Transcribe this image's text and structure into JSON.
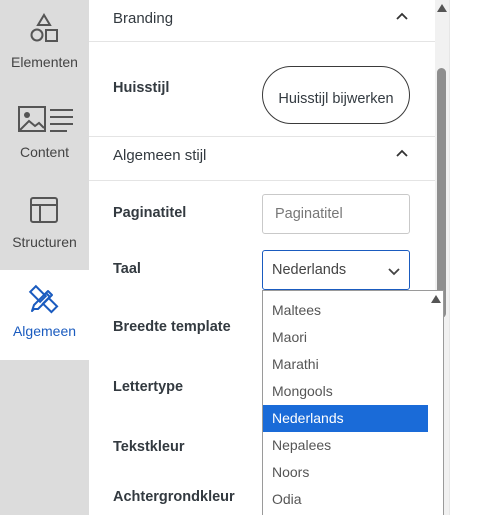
{
  "rail": {
    "items": [
      {
        "label": "Elementen",
        "icon": "shapes-icon"
      },
      {
        "label": "Content",
        "icon": "image-text-icon"
      },
      {
        "label": "Structuren",
        "icon": "layout-icon"
      },
      {
        "label": "Algemeen",
        "icon": "pencil-ruler-icon",
        "active": true
      }
    ]
  },
  "sections": {
    "branding": {
      "title": "Branding"
    },
    "huisstijl": {
      "label": "Huisstijl",
      "button": "Huisstijl bijwerken"
    },
    "algemeen": {
      "title": "Algemeen stijl"
    }
  },
  "fields": {
    "paginatitel": {
      "label": "Paginatitel",
      "placeholder": "Paginatitel"
    },
    "taal": {
      "label": "Taal",
      "value": "Nederlands"
    },
    "breedte": {
      "label": "Breedte template"
    },
    "lettertype": {
      "label": "Lettertype"
    },
    "tekstkleur": {
      "label": "Tekstkleur"
    },
    "achtergrond": {
      "label": "Achtergrondkleur"
    }
  },
  "dropdown": {
    "options": [
      "Maltees",
      "Maori",
      "Marathi",
      "Mongools",
      "Nederlands",
      "Nepalees",
      "Noors",
      "Odia"
    ],
    "selected": "Nederlands"
  },
  "colors": {
    "accent": "#1a5bbf",
    "selected": "#1a6bd8",
    "rail": "#dcdcdc"
  }
}
